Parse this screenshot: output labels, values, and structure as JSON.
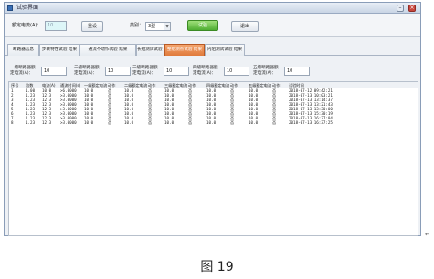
{
  "window": {
    "title": "试验界面"
  },
  "top": {
    "rated_label": "额定电流(A)：",
    "rated_value": "10",
    "reset_label": "重设",
    "type_label": "类别：",
    "type_value": "3型",
    "test_label": "试验",
    "exit_label": "退出"
  },
  "tabs": [
    "断路器信息",
    "步转特性试验 结果",
    "通流不动作试验 结果",
    "长短测试试验 结果",
    "整组测点试验 结果",
    "内阻测试试验 结果"
  ],
  "active_tab_index": 4,
  "rated": [
    {
      "label": "一级断路器额定电流(A)：",
      "value": "10"
    },
    {
      "label": "二级断路器额定电流(A)：",
      "value": "10"
    },
    {
      "label": "三级断路器额定电流(A)：",
      "value": "10"
    },
    {
      "label": "四级断路器额定电流(A)：",
      "value": "10"
    },
    {
      "label": "五级断路器额定电流(A)：",
      "value": "10"
    }
  ],
  "table": {
    "columns": [
      "序号",
      "倍数",
      "电流(A)",
      "通流时间(s)",
      "一级额定电流",
      "动作",
      "二级额定电流",
      "动作",
      "三级额定电流",
      "动作",
      "四级额定电流",
      "动作",
      "五级额定电流",
      "动作",
      "试验时间"
    ],
    "rows": [
      [
        "1",
        "1.00",
        "10.0",
        ">6.0000",
        "10.0",
        "否",
        "10.0",
        "否",
        "10.0",
        "否",
        "10.0",
        "否",
        "10.0",
        "否",
        "2018-07-12 09:42:21"
      ],
      [
        "2",
        "1.23",
        "12.3",
        ">3.0000",
        "10.0",
        "否",
        "10.0",
        "否",
        "10.0",
        "否",
        "10.0",
        "否",
        "10.0",
        "否",
        "2018-07-13 10:03:21"
      ],
      [
        "3",
        "1.23",
        "12.3",
        ">3.0000",
        "10.0",
        "否",
        "10.0",
        "否",
        "10.0",
        "否",
        "10.0",
        "否",
        "10.0",
        "否",
        "2018-07-13 13:14:37"
      ],
      [
        "4",
        "1.23",
        "12.3",
        ">3.0000",
        "10.0",
        "否",
        "10.0",
        "否",
        "10.0",
        "否",
        "10.0",
        "否",
        "10.0",
        "否",
        "2018-07-13 13:21:43"
      ],
      [
        "5",
        "1.23",
        "12.3",
        ">3.0000",
        "10.0",
        "否",
        "10.0",
        "否",
        "10.0",
        "否",
        "10.0",
        "否",
        "10.0",
        "否",
        "2018-07-13 13:30:00"
      ],
      [
        "6",
        "1.23",
        "12.3",
        ">3.0000",
        "10.0",
        "否",
        "10.0",
        "否",
        "10.0",
        "否",
        "10.0",
        "否",
        "10.0",
        "否",
        "2018-07-13 15:30:19"
      ],
      [
        "7",
        "1.23",
        "12.3",
        ">3.0000",
        "10.0",
        "否",
        "10.0",
        "否",
        "10.0",
        "否",
        "10.0",
        "否",
        "10.0",
        "否",
        "2018-07-13 16:37:04"
      ],
      [
        "8",
        "1.23",
        "12.3",
        ">3.0000",
        "10.0",
        "否",
        "10.0",
        "否",
        "10.0",
        "否",
        "10.0",
        "否",
        "10.0",
        "否",
        "2018-07-13 16:37:25"
      ]
    ]
  },
  "caption": "图 19",
  "colors": {
    "accent_tab": "#e07a3c",
    "test_button": "#4fae32"
  }
}
